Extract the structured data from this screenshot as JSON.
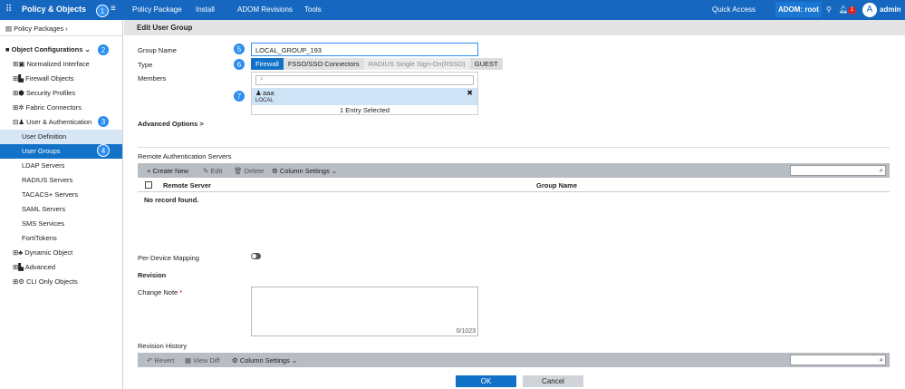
{
  "topbar": {
    "app": "Policy & Objects",
    "menu": [
      "Policy Package",
      "Install",
      "ADOM Revisions",
      "Tools"
    ],
    "quick_access": "Quick Access",
    "adom": "ADOM: root",
    "notif_count": "1",
    "avatar": "A",
    "user": "admin"
  },
  "sidebar": {
    "policy_packages": "Policy Packages",
    "object_config": "Object Configurations",
    "items": [
      "Normalized Interface",
      "Firewall Objects",
      "Security Profiles",
      "Fabric Connectors",
      "User & Authentication"
    ],
    "sub_items": [
      "User Definition",
      "User Groups",
      "LDAP Servers",
      "RADIUS Servers",
      "TACACS+ Servers",
      "SAML Servers",
      "SMS Services",
      "FortiTokens"
    ],
    "items2": [
      "Dynamic Object",
      "Advanced",
      "CLI Only Objects"
    ]
  },
  "badges": [
    "1",
    "2",
    "3",
    "4",
    "5",
    "6",
    "7"
  ],
  "form": {
    "title": "Edit User Group",
    "group_name_label": "Group Name",
    "group_name": "LOCAL_GROUP_193",
    "type_label": "Type",
    "types": [
      "Firewall",
      "FSSO/SSO Connectors",
      "RADIUS Single Sign-On(RSSO)",
      "GUEST"
    ],
    "members_label": "Members",
    "member_name": "aaa",
    "member_type": "LOCAL",
    "selected": "1 Entry Selected",
    "advanced": "Advanced Options >"
  },
  "remote": {
    "title": "Remote Authentication Servers",
    "create": "+ Create New",
    "edit": "Edit",
    "delete": "Delete",
    "colset": "Column Settings",
    "col1": "Remote Server",
    "col2": "Group Name",
    "empty": "No record found."
  },
  "mapping_label": "Per-Device Mapping",
  "revision": {
    "title": "Revision",
    "note_label": "Change Note",
    "counter": "0/1023",
    "history": "Revision History",
    "revert": "Revert",
    "view_diff": "View Diff",
    "colset": "Column Settings"
  },
  "buttons": {
    "ok": "OK",
    "cancel": "Cancel"
  }
}
